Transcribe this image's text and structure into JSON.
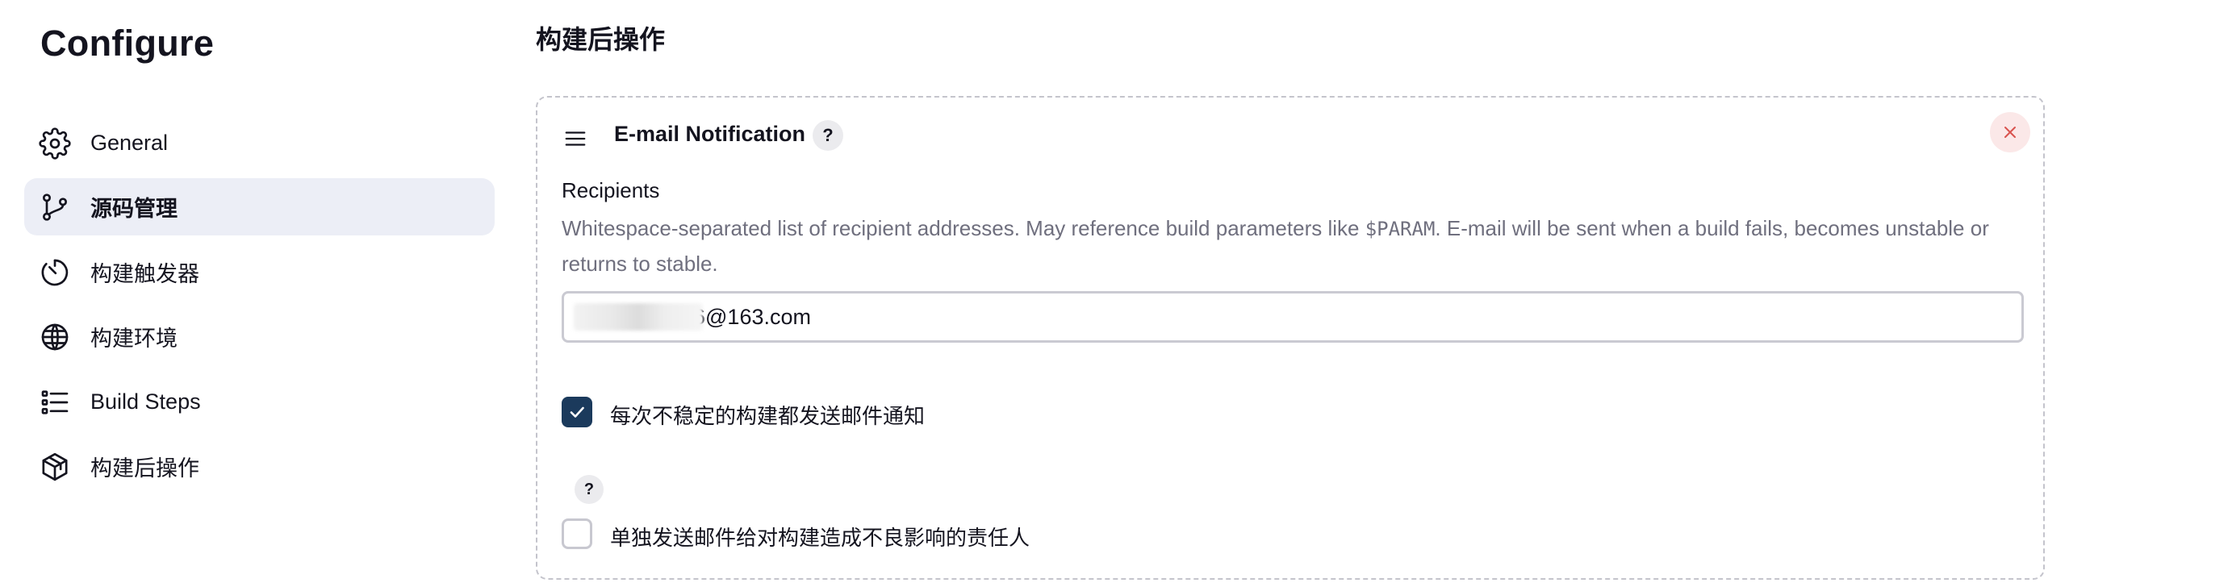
{
  "sidebar": {
    "title": "Configure",
    "items": [
      {
        "label": "General",
        "icon": "gear-icon",
        "active": false
      },
      {
        "label": "源码管理",
        "icon": "git-branch-icon",
        "active": true
      },
      {
        "label": "构建触发器",
        "icon": "timer-icon",
        "active": false
      },
      {
        "label": "构建环境",
        "icon": "globe-icon",
        "active": false
      },
      {
        "label": "Build Steps",
        "icon": "list-icon",
        "active": false
      },
      {
        "label": "构建后操作",
        "icon": "package-icon",
        "active": false
      }
    ]
  },
  "main": {
    "section_title": "构建后操作",
    "card": {
      "title": "E-mail Notification",
      "help_glyph": "?",
      "recipients": {
        "label": "Recipients",
        "description_before": "Whitespace-separated list of recipient addresses. May reference build parameters like ",
        "description_code": "$PARAM",
        "description_after": ". E-mail will be sent when a build fails, becomes unstable or returns to stable.",
        "value": "6@163.com"
      },
      "options": [
        {
          "label": "每次不稳定的构建都发送邮件通知",
          "checked": true
        },
        {
          "label": "单独发送邮件给对构建造成不良影响的责任人",
          "checked": false,
          "help_glyph": "?"
        }
      ]
    }
  },
  "colors": {
    "active_bg": "#eceef6",
    "checkbox_checked": "#1b3a5c",
    "close_bg": "#fbe8e8",
    "close_x": "#d9534f",
    "muted_text": "#6f6f7e"
  }
}
